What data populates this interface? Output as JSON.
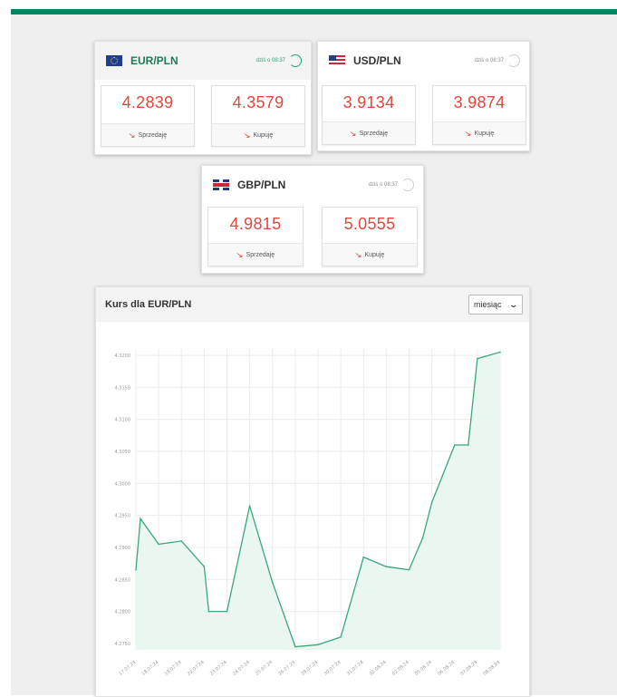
{
  "colors": {
    "accent": "#00855f",
    "rate": "#e0473d",
    "line": "#3aa77a",
    "area": "#eaf6f0"
  },
  "cards": [
    {
      "pair": "EUR/PLN",
      "flag": "eu-flag-icon",
      "updated": "dziś o 08:37",
      "active": true,
      "sell": {
        "value": "4.2839",
        "label": "Sprzedaję"
      },
      "buy": {
        "value": "4.3579",
        "label": "Kupuję"
      }
    },
    {
      "pair": "USD/PLN",
      "flag": "us-flag-icon",
      "updated": "dziś o 08:37",
      "active": false,
      "sell": {
        "value": "3.9134",
        "label": "Sprzedaję"
      },
      "buy": {
        "value": "3.9874",
        "label": "Kupuję"
      }
    },
    {
      "pair": "GBP/PLN",
      "flag": "gb-flag-icon",
      "updated": "dziś o 08:37",
      "active": false,
      "sell": {
        "value": "4.9815",
        "label": "Sprzedaję"
      },
      "buy": {
        "value": "5.0555",
        "label": "Kupuję"
      }
    }
  ],
  "chart_panel": {
    "title": "Kurs dla EUR/PLN",
    "period_selected": "miesiąc"
  },
  "chart_data": {
    "type": "area",
    "title": "Kurs dla EUR/PLN",
    "xlabel": "",
    "ylabel": "",
    "ylim": [
      4.274,
      4.321
    ],
    "grid": true,
    "y_ticks": [
      "4.3200",
      "4.3150",
      "4.3100",
      "4.3050",
      "4.3000",
      "4.2950",
      "4.2900",
      "4.2850",
      "4.2800",
      "4.2750"
    ],
    "x_tick_labels": [
      "17.07.24",
      "18.07.24",
      "19.07.24",
      "22.07.24",
      "23.07.24",
      "24.07.24",
      "25.07.24",
      "26.07.24",
      "29.07.24",
      "30.07.24",
      "31.07.24",
      "01.08.24",
      "02.08.24",
      "05.08.24",
      "06.08.24",
      "07.08.24",
      "08.08.24"
    ],
    "x": [
      0,
      0.2,
      1,
      2,
      3,
      3.2,
      4,
      5,
      6,
      7,
      8,
      9,
      10,
      11,
      12,
      12.6,
      13,
      14,
      14.6,
      15,
      16
    ],
    "y": [
      4.2865,
      4.2945,
      4.2905,
      4.291,
      4.287,
      4.28,
      4.28,
      4.2965,
      4.2845,
      4.2745,
      4.2748,
      4.276,
      4.2885,
      4.287,
      4.2865,
      4.2915,
      4.297,
      4.306,
      4.306,
      4.3195,
      4.3205
    ]
  }
}
